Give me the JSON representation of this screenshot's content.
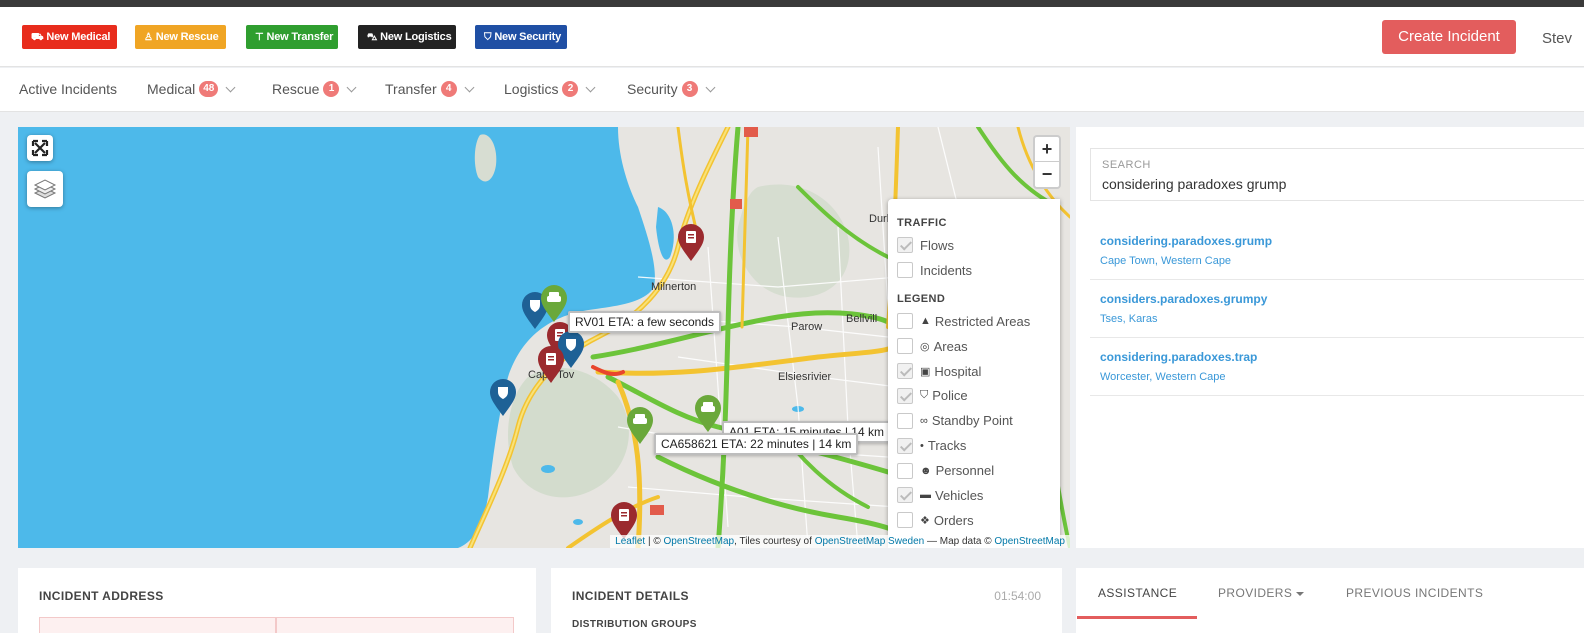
{
  "header": {
    "new_buttons": [
      {
        "label": "New Medical",
        "icon": "ambulance-icon",
        "color": "#e82c1c"
      },
      {
        "label": "New Rescue",
        "icon": "lifeguard-icon",
        "color": "#f0a524"
      },
      {
        "label": "New Transfer",
        "icon": "transfer-icon",
        "color": "#2f9e2f"
      },
      {
        "label": "New Logistics",
        "icon": "cart-icon",
        "color": "#222222"
      },
      {
        "label": "New Security",
        "icon": "shield-icon",
        "color": "#1f4fa4"
      }
    ],
    "create_incident": "Create Incident",
    "user_name": "Stev"
  },
  "nav": {
    "active_incidents": "Active Incidents",
    "items": [
      {
        "label": "Medical",
        "count": "48"
      },
      {
        "label": "Rescue",
        "count": "1"
      },
      {
        "label": "Transfer",
        "count": "4"
      },
      {
        "label": "Logistics",
        "count": "2"
      },
      {
        "label": "Security",
        "count": "3"
      }
    ]
  },
  "map": {
    "place_labels": {
      "milnerton": "Milnerton",
      "cape_town": "Cape Tov",
      "elsies": "Elsiesrivier",
      "parow": "Parow",
      "bellville": "Bellvill",
      "durb": "Durb"
    },
    "tooltips": {
      "rv01": "RV01 ETA: a few seconds",
      "a01": "A01 ETA: 15 minutes | 14 km",
      "ca658621": "CA658621 ETA: 22 minutes | 14 km"
    },
    "zoom_in": "+",
    "zoom_out": "−",
    "layers": {
      "traffic_title": "TRAFFIC",
      "traffic": [
        {
          "label": "Flows",
          "checked": true
        },
        {
          "label": "Incidents",
          "checked": false
        }
      ],
      "legend_title": "LEGEND",
      "legend": [
        {
          "label": "Restricted Areas",
          "icon": "warning-icon",
          "glyph": "▲",
          "checked": false
        },
        {
          "label": "Areas",
          "icon": "target-icon",
          "glyph": "◎",
          "checked": false
        },
        {
          "label": "Hospital",
          "icon": "hospital-icon",
          "glyph": "▣",
          "checked": true
        },
        {
          "label": "Police",
          "icon": "shield-icon",
          "glyph": "⛉",
          "checked": true
        },
        {
          "label": "Standby Point",
          "icon": "binoculars-icon",
          "glyph": "∞",
          "checked": false
        },
        {
          "label": "Tracks",
          "icon": "pin-icon",
          "glyph": "•",
          "checked": true
        },
        {
          "label": "Personnel",
          "icon": "users-icon",
          "glyph": "☻",
          "checked": false
        },
        {
          "label": "Vehicles",
          "icon": "car-icon",
          "glyph": "▬",
          "checked": true
        },
        {
          "label": "Orders",
          "icon": "cubes-icon",
          "glyph": "❖",
          "checked": false
        }
      ]
    },
    "attribution": {
      "leaflet": "Leaflet",
      "sep1": " | © ",
      "osm": "OpenStreetMap",
      "tiles": ", Tiles courtesy of ",
      "osm_sweden": "OpenStreetMap Sweden",
      "data": " — Map data © ",
      "osm2": "OpenStreetMap"
    }
  },
  "search": {
    "label": "SEARCH",
    "value": "considering paradoxes grump",
    "results": [
      {
        "title": "considering.paradoxes.grump",
        "subtitle": "Cape Town, Western Cape"
      },
      {
        "title": "considers.paradoxes.grumpy",
        "subtitle": "Tses, Karas"
      },
      {
        "title": "considering.paradoxes.trap",
        "subtitle": "Worcester, Western Cape"
      }
    ]
  },
  "incident_address": {
    "title": "INCIDENT ADDRESS"
  },
  "incident_details": {
    "title": "INCIDENT DETAILS",
    "time": "01:54:00",
    "subtitle": "DISTRIBUTION GROUPS"
  },
  "assistance_tabs": [
    {
      "label": "ASSISTANCE",
      "active": true
    },
    {
      "label": "PROVIDERS",
      "dropdown": true
    },
    {
      "label": "PREVIOUS INCIDENTS"
    }
  ]
}
